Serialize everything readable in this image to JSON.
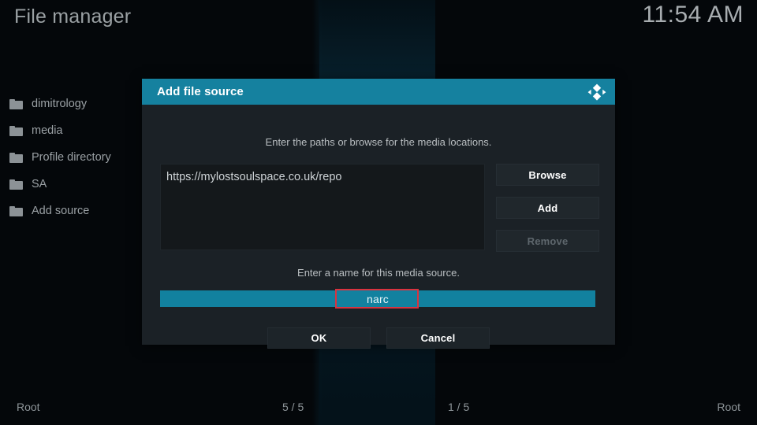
{
  "window": {
    "title": "File manager",
    "clock": "11:54 AM",
    "accent_teal": "#15819f",
    "field_teal": "#12819f",
    "panel_bg": "#1b2126",
    "annotation_color": "#d9333f"
  },
  "filelist": {
    "items": [
      {
        "label": "dimitrology",
        "icon": "folder-icon"
      },
      {
        "label": "media",
        "icon": "folder-icon"
      },
      {
        "label": "Profile directory",
        "icon": "folder-icon"
      },
      {
        "label": "SA",
        "icon": "folder-icon"
      },
      {
        "label": "Add source",
        "icon": "folder-icon"
      }
    ]
  },
  "dialog": {
    "title": "Add file source",
    "logo_icon": "kodi-logo-icon",
    "paths_hint": "Enter the paths or browse for the media locations.",
    "paths": [
      "https://mylostsoulspace.co.uk/repo"
    ],
    "side_buttons": [
      {
        "label": "Browse",
        "enabled": true
      },
      {
        "label": "Add",
        "enabled": true
      },
      {
        "label": "Remove",
        "enabled": false
      }
    ],
    "name_hint": "Enter a name for this media source.",
    "name_value": "narc",
    "name_placeholder": "",
    "bottom_buttons": [
      {
        "label": "OK"
      },
      {
        "label": "Cancel"
      }
    ]
  },
  "footer": {
    "left_label": "Root",
    "left_count": "5 / 5",
    "right_count": "1 / 5",
    "right_label": "Root"
  }
}
